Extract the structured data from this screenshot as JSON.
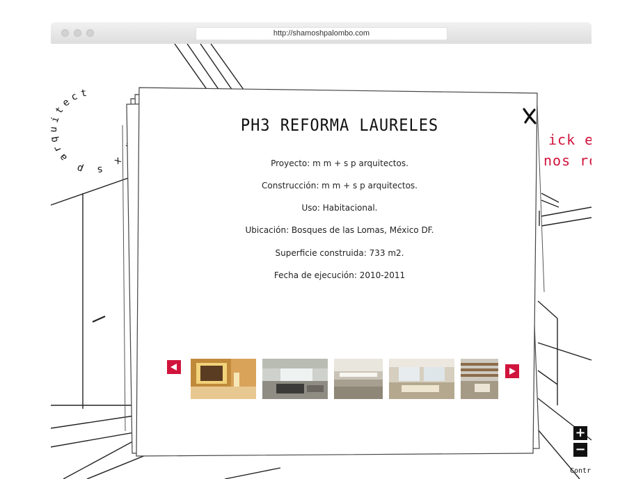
{
  "browser": {
    "url": "http://shamoshpalombo.com"
  },
  "logo": {
    "circular_text": "mm x s p arquitectos"
  },
  "background": {
    "red_line_1": "ick e",
    "red_line_2": "nos ro",
    "controls_label": "Contr",
    "zoom_in_label": "+",
    "zoom_out_label": "−"
  },
  "modal": {
    "title": "PH3 REFORMA LAURELES",
    "close_label": "X",
    "details": [
      "Proyecto: m m + s p arquitectos.",
      "Construcción: m m + s p arquitectos.",
      "Uso: Habitacional.",
      "Ubicación: Bosques de las Lomas, México DF.",
      "Superficie construida: 733 m2.",
      "Fecha de ejecución: 2010-2011"
    ]
  },
  "colors": {
    "accent_red": "#d0143c",
    "ink": "#111111"
  },
  "icons": {
    "close": "close-x-icon",
    "prev": "triangle-left-icon",
    "next": "triangle-right-icon",
    "zoom_in": "plus-icon",
    "zoom_out": "minus-icon"
  }
}
